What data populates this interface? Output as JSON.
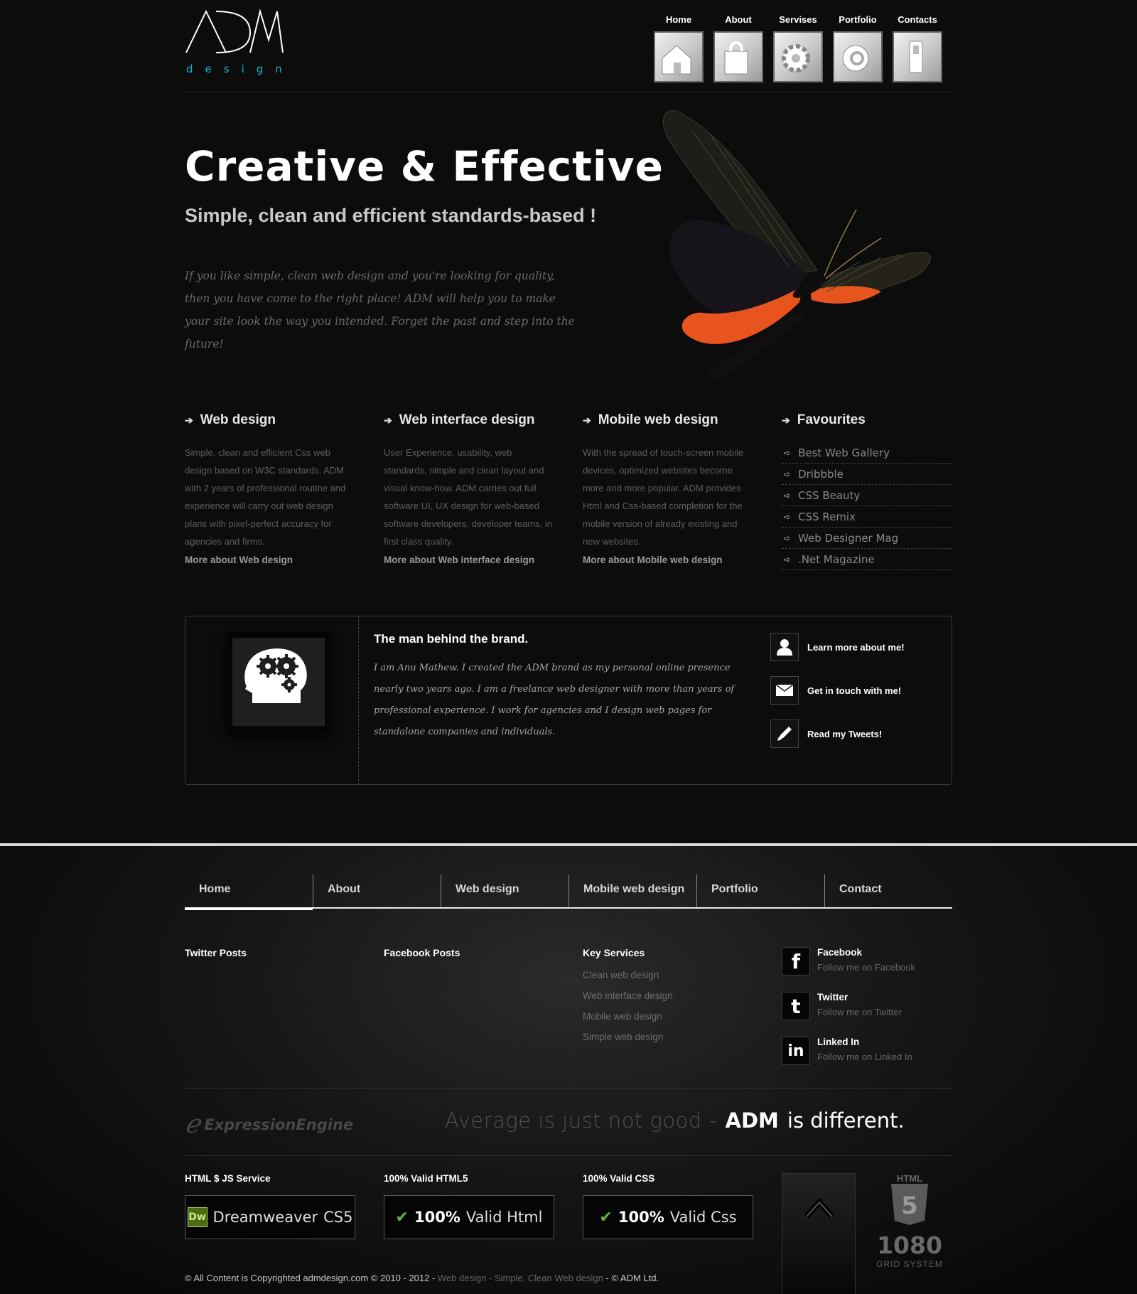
{
  "header": {
    "logo_main": "ADM",
    "logo_sub": "design",
    "nav": [
      {
        "label": "Home",
        "icon": "house-icon"
      },
      {
        "label": "About",
        "icon": "shopping-bag-icon"
      },
      {
        "label": "Servises",
        "icon": "gear-icon"
      },
      {
        "label": "Portfolio",
        "icon": "portfolio-icon"
      },
      {
        "label": "Contacts",
        "icon": "phone-icon"
      }
    ]
  },
  "hero": {
    "title": "Creative & Effective",
    "subtitle": "Simple, clean and efficient standards-based !",
    "text": "If you like simple, clean web design and you're looking for quality, then you have come to the right place! ADM will help you to make your site look the way you intended. Forget the past and step into the future!"
  },
  "services": [
    {
      "title": "Web design",
      "text": "Simple, clean and efficient Css web design based on W3C standards. ADM with 2 years of professional routine and experience will carry out web design plans with pixel-perfect accuracy for agencies and firms.",
      "more": "More about Web design"
    },
    {
      "title": "Web interface design",
      "text": "User Experience, usability, web standards, simple and clean layout and visual know-how. ADM carries out full software UI, UX design for web-based software developers, developer teams, in first class quality.",
      "more": "More about Web interface design"
    },
    {
      "title": "Mobile web design",
      "text": "With the spread of touch-screen mobile devices, optimized websites become more and more popular. ADM provides Html and Css-based completion for the mobile version of already existing and new websites.",
      "more": "More about Mobile web design"
    }
  ],
  "favourites": {
    "title": "Favourites",
    "items": [
      "Best Web Gallery",
      "Dribbble",
      "CSS Beauty",
      "CSS Remix",
      "Web Designer Mag",
      ".Net Magazine"
    ]
  },
  "about": {
    "title": "The man behind the brand.",
    "text": "I am Anu Mathew. I created the ADM brand as my personal online presence nearly two years ago. I am a freelance web designer with more than years of professional experience. I work for agencies and I design web pages for standalone companies and individuals.",
    "links": [
      {
        "label": "Learn more about me!",
        "icon": "user-icon"
      },
      {
        "label": "Get in touch with me!",
        "icon": "envelope-icon"
      },
      {
        "label": "Read my Tweets!",
        "icon": "pencil-icon"
      }
    ]
  },
  "footer_nav": [
    "Home",
    "About",
    "Web design",
    "Mobile web design",
    "Portfolio",
    "Contact"
  ],
  "footer_cols": {
    "twitter_title": "Twitter Posts",
    "facebook_title": "Facebook Posts",
    "key_services_title": "Key Services",
    "key_services": [
      "Clean web design",
      "Web interface design",
      "Mobile web design",
      "Simple web design"
    ],
    "social": [
      {
        "title": "Facebook",
        "sub": "Follow me on Facebook",
        "icon": "facebook-icon",
        "glyph": "f"
      },
      {
        "title": "Twitter",
        "sub": "Follow me on Twitter",
        "icon": "twitter-icon",
        "glyph": "t"
      },
      {
        "title": "Linked In",
        "sub": "Follow me on Linked In",
        "icon": "linkedin-icon",
        "glyph": "in"
      }
    ]
  },
  "tagline": {
    "ee_logo": "ExpressionEngine",
    "grey": "Average is just not good  -",
    "brand": "ADM",
    "rest": "is different."
  },
  "badges": [
    {
      "title": "HTML $ JS Service",
      "box_bold": "Dreamweaver",
      "box_rest": "CS5",
      "icon": "dw"
    },
    {
      "title": "100% Valid HTML5",
      "box_bold": "100%",
      "box_rest": "Valid Html",
      "icon": "check"
    },
    {
      "title": "100% Valid CSS",
      "box_bold": "100%",
      "box_rest": "Valid Css",
      "icon": "check"
    }
  ],
  "html5_badge": {
    "label": "HTML",
    "digit": "5",
    "num": "1080",
    "sys": "GRID SYSTEM"
  },
  "copyright": {
    "main": "© All Content is Copyrighted admdesign.com © 2010 - 2012 -",
    "link1": "Web design",
    "sep": "-",
    "link2": "Simple, Clean Web design",
    "end": "- © ADM Ltd."
  },
  "colors": {
    "background": "#0c0c0c",
    "logo_accent": "#0fb4d0",
    "butterfly_accent": "#e8541e"
  }
}
